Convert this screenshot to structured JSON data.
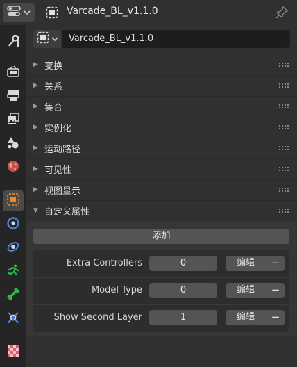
{
  "header": {
    "object_name": "Varcade_BL_v1.1.0",
    "editor_icon": "properties-editor-icon",
    "pin_icon": "pin-icon"
  },
  "datablock": {
    "name": "Varcade_BL_v1.1.0"
  },
  "tabs": [
    {
      "name": "tool",
      "icon": "wrench-screwdriver-icon",
      "active": false
    },
    {
      "name": "render",
      "icon": "camera-back-icon",
      "active": false
    },
    {
      "name": "output",
      "icon": "printer-icon",
      "active": false
    },
    {
      "name": "view-layer",
      "icon": "image-stack-icon",
      "active": false
    },
    {
      "name": "scene",
      "icon": "scene-cone-sphere-icon",
      "active": false
    },
    {
      "name": "world",
      "icon": "world-globe-icon",
      "active": false
    },
    {
      "name": "object",
      "icon": "object-square-icon",
      "active": true
    },
    {
      "name": "modifiers",
      "icon": "blue-circle-dot-icon",
      "active": false
    },
    {
      "name": "particles",
      "icon": "particles-icon",
      "active": false
    },
    {
      "name": "physics",
      "icon": "running-figure-icon",
      "active": false
    },
    {
      "name": "constraints",
      "icon": "bone-icon",
      "active": false
    },
    {
      "name": "object-data",
      "icon": "wrench-x-icon",
      "active": false
    },
    {
      "name": "texture",
      "icon": "checker-icon",
      "active": false
    }
  ],
  "sections": [
    {
      "label": "变换",
      "expanded": false
    },
    {
      "label": "关系",
      "expanded": false
    },
    {
      "label": "集合",
      "expanded": false
    },
    {
      "label": "实例化",
      "expanded": false
    },
    {
      "label": "运动路径",
      "expanded": false
    },
    {
      "label": "可见性",
      "expanded": false
    },
    {
      "label": "视图显示",
      "expanded": false
    },
    {
      "label": "自定义属性",
      "expanded": true
    }
  ],
  "custom_properties": {
    "add_label": "添加",
    "edit_label": "编辑",
    "remove_label": "−",
    "items": [
      {
        "name": "Extra Controllers",
        "value": "0"
      },
      {
        "name": "Model Type",
        "value": "0"
      },
      {
        "name": "Show Second Layer",
        "value": "1"
      }
    ]
  },
  "colors": {
    "accent_orange": "#e88a2e",
    "panel_bg": "#303030",
    "tab_strip_bg": "#252525",
    "field_bg": "#545454"
  }
}
